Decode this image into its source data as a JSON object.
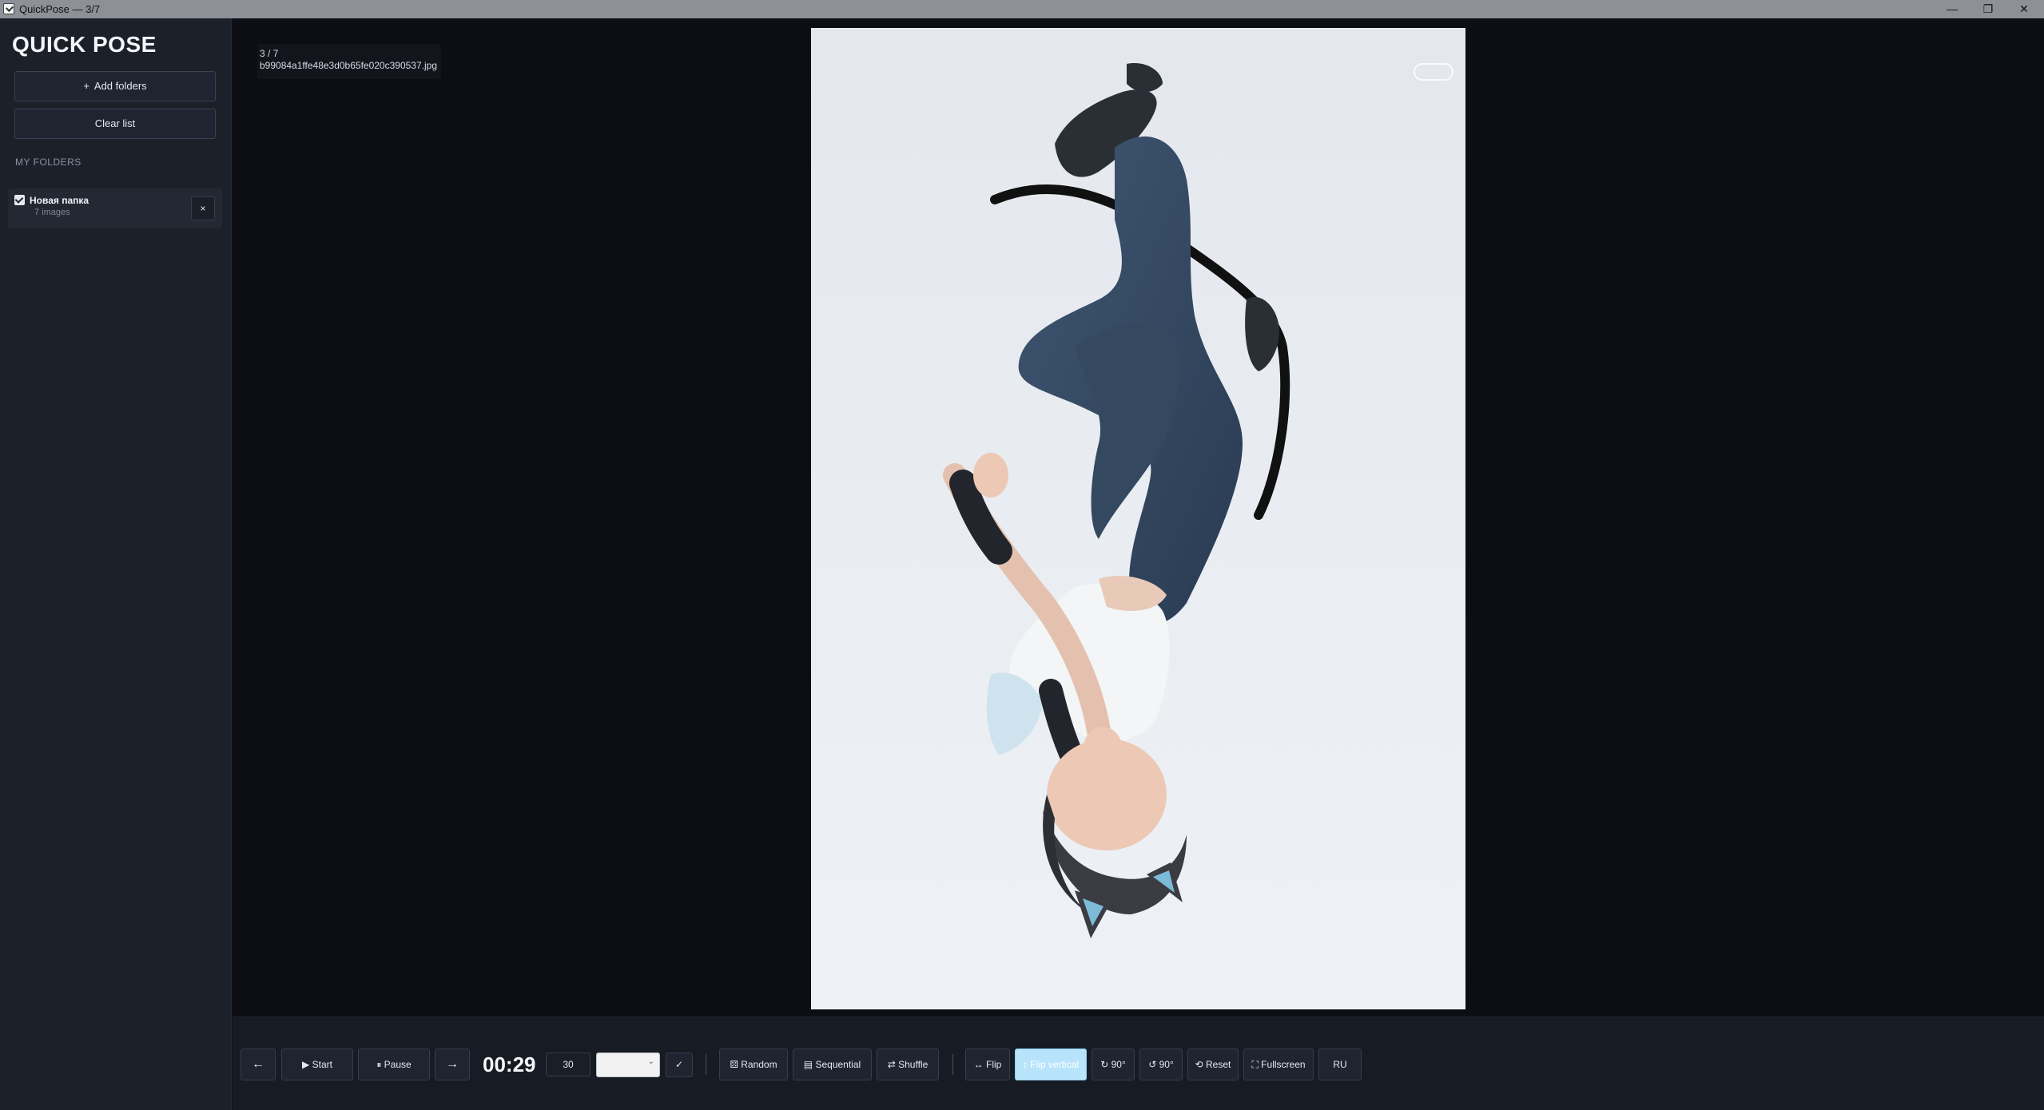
{
  "window": {
    "title": "QuickPose — 3/7",
    "minimize": "—",
    "maximize": "❐",
    "close": "✕"
  },
  "sidebar": {
    "logo": "QUICK POSE",
    "add_folders": "Add folders",
    "add_icon": "+",
    "clear_list": "Clear list",
    "section_label": "MY FOLDERS",
    "folders": [
      {
        "name": "Новая папка",
        "count": "7 images",
        "checked": true,
        "remove": "×"
      }
    ]
  },
  "viewer": {
    "counter": "3 / 7",
    "filename": "b99084a1ffe48e3d0b65fe020c390537.jpg",
    "transform": "flip-vertical"
  },
  "toolbar": {
    "prev": "←",
    "start": "▶ Start",
    "pause": "⏸ Pause",
    "next": "→",
    "timer": "00:29",
    "seconds": "30",
    "select_caret": "⌄",
    "confirm": "✓",
    "random": "Random",
    "sequential": "Sequential",
    "shuffle": "Shuffle",
    "flip": "↔ Flip",
    "flip_vertical": "↕ Flip vertical",
    "rotate_cw": "↻ 90°",
    "rotate_ccw": "↺ 90°",
    "reset": "⟲ Reset",
    "fullscreen": "⛶ Fullscreen",
    "language": "RU"
  }
}
